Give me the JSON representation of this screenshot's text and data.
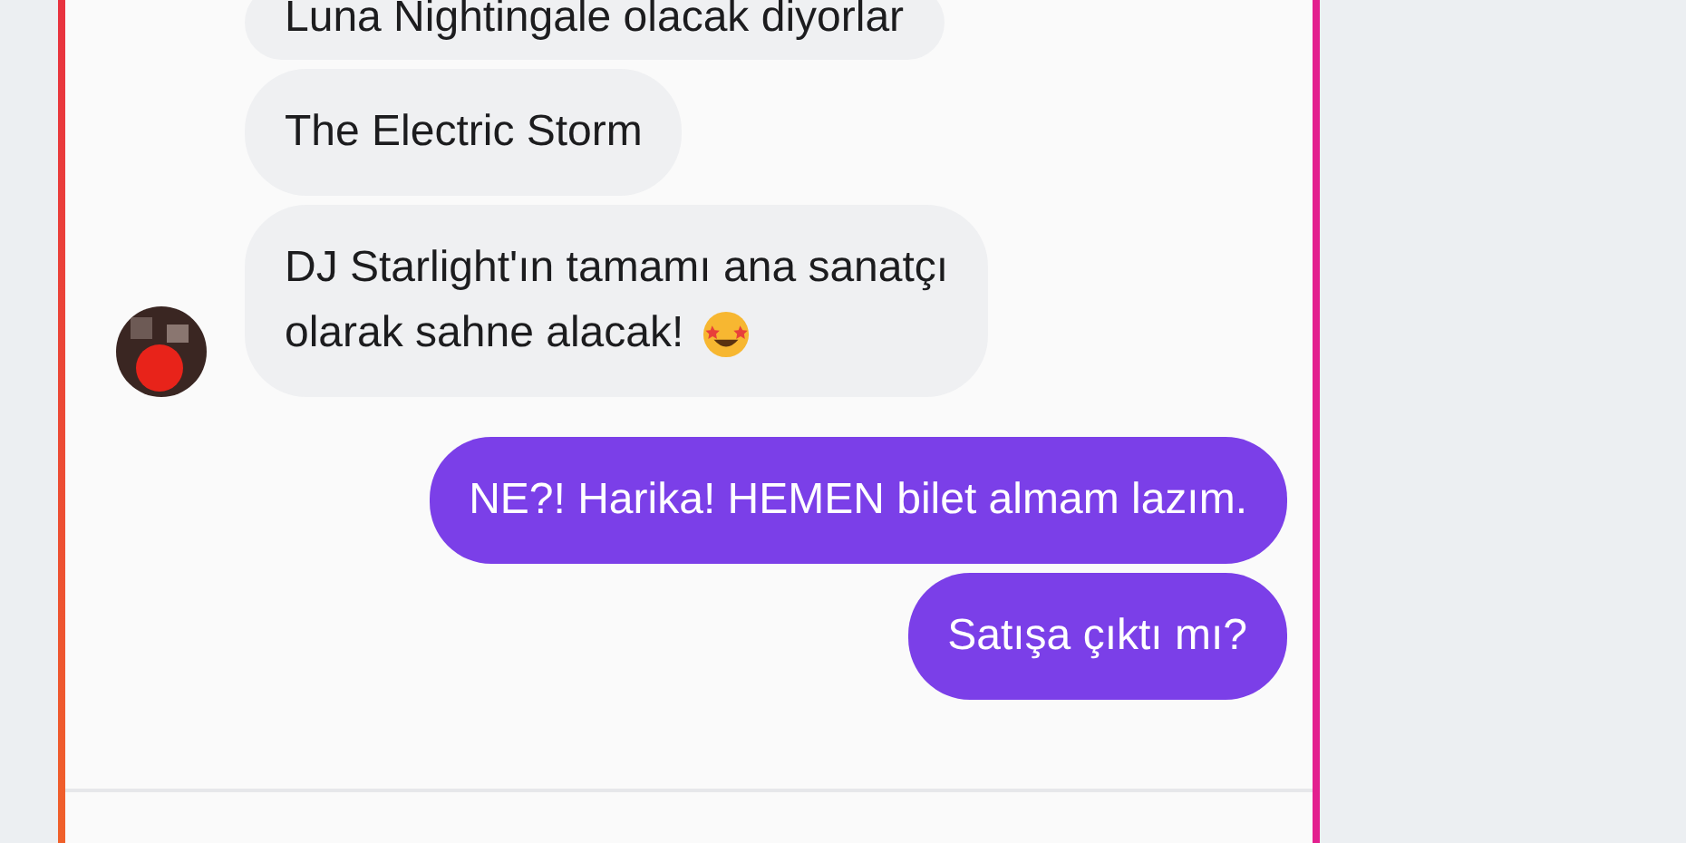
{
  "messages": [
    {
      "outgoing": false,
      "kind": "plain",
      "lines": [
        "Luna Nightingale olacak diyorlar"
      ],
      "avatar": false
    },
    {
      "outgoing": false,
      "kind": "plain",
      "lines": [
        "The Electric Storm"
      ],
      "avatar": false
    },
    {
      "outgoing": false,
      "kind": "emoji",
      "lines": [
        "DJ Starlight'ın tamamı ana sanatçı",
        "olarak sahne alacak!"
      ],
      "avatar": true
    },
    {
      "outgoing": true,
      "kind": "plain",
      "lines": [
        "NE?! Harika! HEMEN bilet almam lazım."
      ],
      "avatar": false
    },
    {
      "outgoing": true,
      "kind": "plain",
      "lines": [
        "Satışa çıktı mı?"
      ],
      "avatar": false
    }
  ]
}
